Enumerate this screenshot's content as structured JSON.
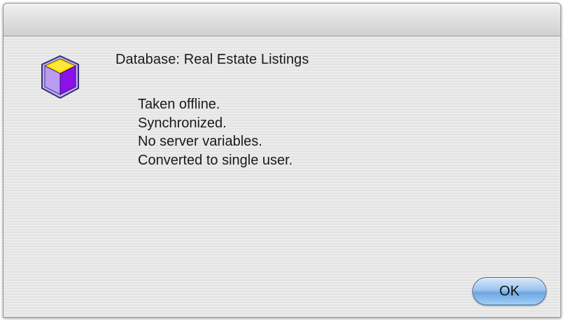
{
  "dialog": {
    "icon": "database-cube-icon",
    "title": "Database: Real Estate Listings",
    "lines": [
      "Taken offline.",
      "Synchronized.",
      "No server variables.",
      "Converted to single user."
    ],
    "ok_label": "OK"
  },
  "colors": {
    "button_blue": "#8fbfee",
    "icon_yellow": "#ffe000",
    "icon_purple": "#8a12e8"
  }
}
